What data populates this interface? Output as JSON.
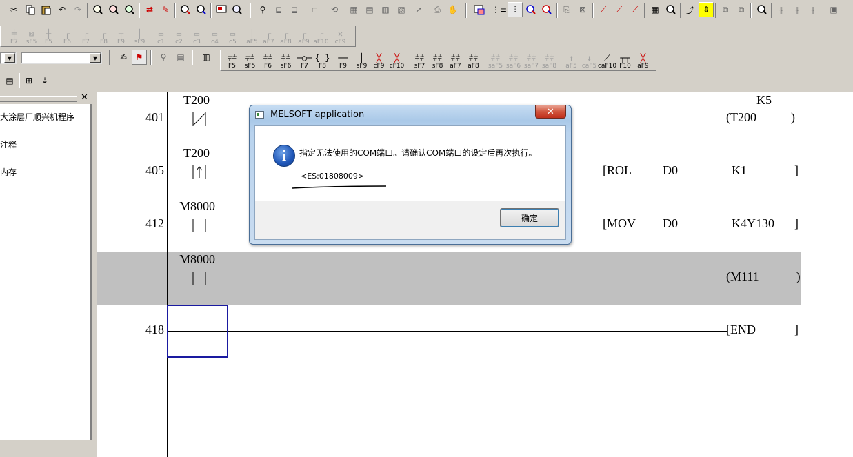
{
  "toolbar": {
    "row2_keys": [
      "F7",
      "sF5",
      "F5",
      "F6",
      "F7",
      "F8",
      "F9",
      "sF9",
      "c1",
      "c2",
      "c3",
      "c4",
      "c5",
      "aF5",
      "aF7",
      "aF8",
      "aF9",
      "aF10",
      "cF9"
    ],
    "row3_keys": [
      "F5",
      "sF5",
      "F6",
      "sF6",
      "F7",
      "F8",
      "F9",
      "sF9",
      "cF9",
      "cF10",
      "sF7",
      "sF8",
      "aF7",
      "aF8",
      "saF5",
      "saF6",
      "saF7",
      "saF8",
      "aF5",
      "caF5",
      "caF10",
      "F10",
      "aF9"
    ]
  },
  "left_panel": {
    "close_symbol": "✕",
    "items": [
      "大涂层厂顺兴机程序",
      "注释",
      "内存"
    ]
  },
  "ladder": {
    "rungs": [
      {
        "step": "401",
        "contact": "T200",
        "coil": "T200",
        "coil_const": "K5"
      },
      {
        "step": "405",
        "contact": "T200",
        "instr": "ROL",
        "op1": "D0",
        "op2": "K1"
      },
      {
        "step": "412",
        "contact": "M8000",
        "instr": "MOV",
        "op1": "D0",
        "op2": "K4Y130"
      },
      {
        "step": "",
        "contact": "M8000",
        "coil": "M111"
      },
      {
        "step": "418",
        "instr": "END"
      }
    ]
  },
  "dialog": {
    "title": "MELSOFT application",
    "message": "指定无法使用的COM端口。请确认COM端口的设定后再次执行。",
    "code": "<ES:01808009>",
    "ok_label": "确定",
    "close_label": "✕"
  }
}
